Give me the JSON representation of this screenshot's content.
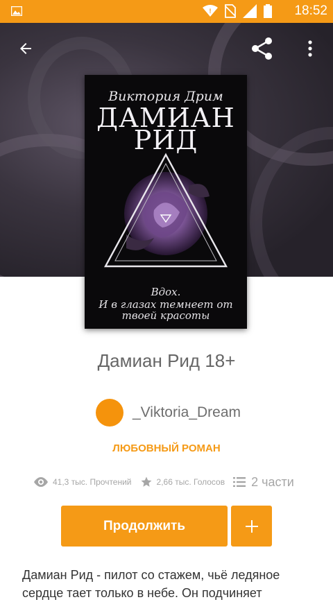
{
  "status_bar": {
    "time": "18:52",
    "icons": [
      "image-icon",
      "wifi-icon",
      "no-sim-icon",
      "signal-icon",
      "battery-icon"
    ],
    "color": "#f59a16"
  },
  "app_bar": {
    "icons": [
      "back-arrow-icon",
      "share-icon",
      "more-vert-icon"
    ]
  },
  "cover": {
    "author": "Виктория Дрим",
    "title_line1": "ДАМИАН",
    "title_line2": "РИД",
    "tagline_line1": "Вдох.",
    "tagline_line2": "И в глазах темнеет от",
    "tagline_line3": "твоей красоты"
  },
  "story": {
    "title": "Дамиан Рид 18+",
    "author": "_Viktoria_Dream",
    "genre": "ЛЮБОВНЫЙ РОМАН",
    "reads": "41,3 тыс. Прочтений",
    "votes": "2,66 тыс. Голосов",
    "parts": "2 части",
    "description": "Дамиан Рид - пилот со стажем, чьё ледяное сердце тает только в небе. Он подчиняет"
  },
  "actions": {
    "continue_label": "Продолжить",
    "add_icon": "plus-icon"
  },
  "colors": {
    "accent": "#f59a16",
    "avatar": "#f5930c"
  }
}
